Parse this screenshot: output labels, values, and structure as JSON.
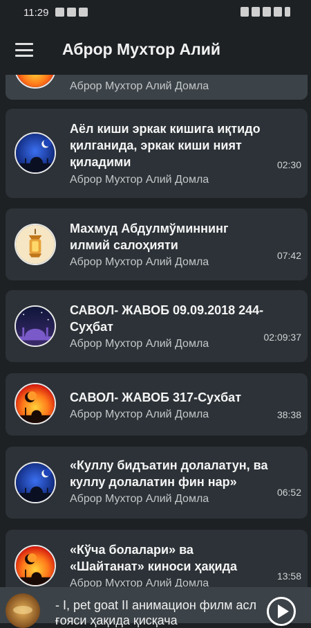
{
  "status_bar": {
    "time": "11:29"
  },
  "app_bar": {
    "title": "Аброр Мухтор Алий"
  },
  "list": {
    "items": [
      {
        "title": "",
        "author": "Аброр Мухтор Алий Домла",
        "duration": "",
        "icon": "orange-crescent-icon"
      },
      {
        "title": "Аёл киши эркак кишига иқтидо қилганида, эркак киши ният қиладими",
        "author": "Аброр Мухтор Алий Домла",
        "duration": "02:30",
        "icon": "night-mosque-icon"
      },
      {
        "title": "Махмуд Абдулмўминнинг илмий салоҳияти",
        "author": "Аброр Мухтор Алий Домла",
        "duration": "07:42",
        "icon": "lantern-icon"
      },
      {
        "title": "САВОЛ- ЖАВОБ 09.09.2018 244-Суҳбат",
        "author": "Аброр Мухтор Алий Домла",
        "duration": "02:09:37",
        "icon": "purple-mosque-icon"
      },
      {
        "title": "САВОЛ- ЖАВОБ 317-Сухбат",
        "author": "Аброр Мухтор Алий Домла",
        "duration": "38:38",
        "icon": "sunset-crescent-icon"
      },
      {
        "title": "«Куллу бидъатин долалатун, ва куллу долалатин фин нар»",
        "author": "Аброр Мухтор Алий Домла",
        "duration": "06:52",
        "icon": "night-mosque-icon"
      },
      {
        "title": "«Кўча болалари» ва «Шайтанат» киноси ҳақида",
        "author": "Аброр Мухтор Алий Домла",
        "duration": "13:58",
        "icon": "sunset-crescent-icon"
      }
    ]
  },
  "player": {
    "title": "- I, pet goat II анимацион филм асл ғояси ҳақида қисқача",
    "art": "gold-artwork-icon"
  },
  "colors": {
    "background": "#1d2124",
    "card": "#2c3237",
    "card_active": "#3c4348"
  }
}
